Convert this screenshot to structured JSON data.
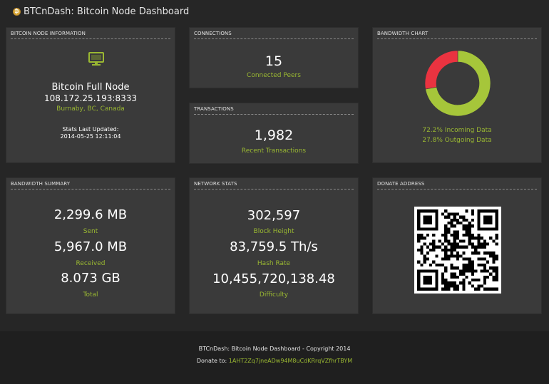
{
  "header": {
    "title": "BTCnDash: Bitcoin Node Dashboard",
    "logo_icon": "bitcoin-coin-icon"
  },
  "node_info": {
    "heading": "BITCOIN NODE INFORMATION",
    "icon": "monitor-icon",
    "node_name": "Bitcoin Full Node",
    "address": "108.172.25.193:8333",
    "location": "Burnaby, BC, Canada",
    "updated_label": "Stats Last Updated:",
    "updated_value": "2014-05-25 12:11:04"
  },
  "connections": {
    "heading": "CONNECTIONS",
    "value": "15",
    "label": "Connected Peers"
  },
  "transactions": {
    "heading": "TRANSACTIONS",
    "value": "1,982",
    "label": "Recent Transactions"
  },
  "bandwidth_chart": {
    "heading": "BANDWIDTH CHART",
    "incoming_label": "72.2% Incoming Data",
    "outgoing_label": "27.8% Outgoing Data",
    "incoming_fraction": 0.722,
    "outgoing_fraction": 0.278,
    "incoming_color": "#a6c63a",
    "outgoing_color": "#ea3340"
  },
  "bandwidth_summary": {
    "heading": "BANDWIDTH SUMMARY",
    "sent_value": "2,299.6 MB",
    "sent_label": "Sent",
    "received_value": "5,967.0 MB",
    "received_label": "Received",
    "total_value": "8.073 GB",
    "total_label": "Total"
  },
  "network_stats": {
    "heading": "NETWORK STATS",
    "block_height_value": "302,597",
    "block_height_label": "Block Height",
    "hash_rate_value": "83,759.5 Th/s",
    "hash_rate_label": "Hash Rate",
    "difficulty_value": "10,455,720,138.48",
    "difficulty_label": "Difficulty"
  },
  "donate": {
    "heading": "DONATE ADDRESS",
    "qr_icon": "qr-code-icon"
  },
  "footer": {
    "copyright": "BTCnDash: Bitcoin Node Dashboard - Copyright 2014",
    "donate_label": "Donate to:",
    "donate_address": "1AHT2Zq7jneADw94M8uCdKRrqVZfhrTBYM"
  },
  "colors": {
    "accent": "#9ab832",
    "panel": "#3a3a3a",
    "background": "#262626"
  }
}
